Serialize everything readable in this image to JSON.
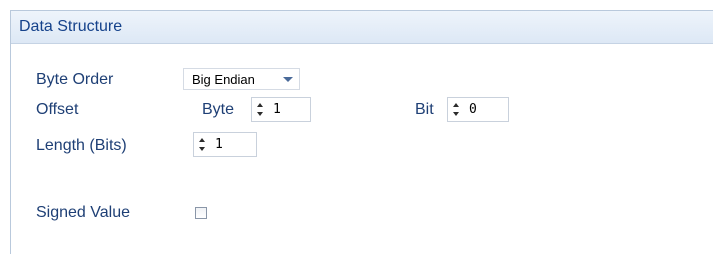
{
  "panel": {
    "title": "Data Structure"
  },
  "fields": {
    "byte_order": {
      "label": "Byte Order",
      "value": "Big Endian"
    },
    "offset": {
      "label": "Offset",
      "byte_label": "Byte",
      "byte_value": "1",
      "bit_label": "Bit",
      "bit_value": "0"
    },
    "length": {
      "label": "Length (Bits)",
      "value": "1"
    },
    "signed": {
      "label": "Signed Value",
      "checked": false
    }
  },
  "colors": {
    "header_bg": "#dde8f5",
    "title_text": "#15428b",
    "label_text": "#1e3f75"
  }
}
